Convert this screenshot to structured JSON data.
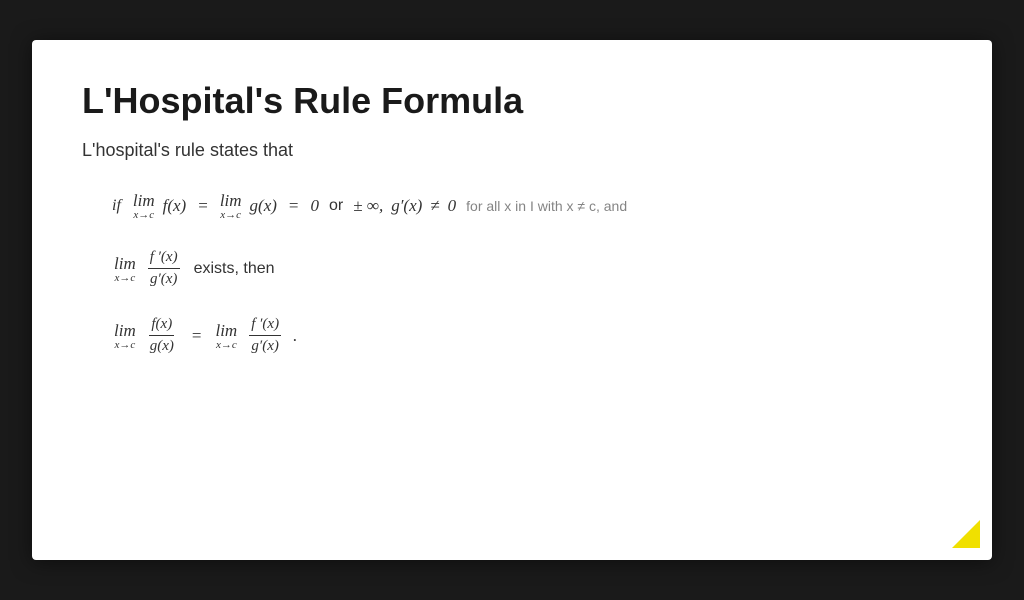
{
  "slide": {
    "title": "L'Hospital's Rule Formula",
    "subtitle": "L'hospital's rule states that",
    "math": {
      "condition": "if lim f(x) = lim g(x) = 0 or ± ∞, g′(x) ≠ 0 for all x in I with x ≠ c, and",
      "condition_line2": "lim f′(x)/g′(x) exists, then",
      "conclusion": "lim f(x)/g(x) = lim f′(x)/g′(x)"
    }
  }
}
